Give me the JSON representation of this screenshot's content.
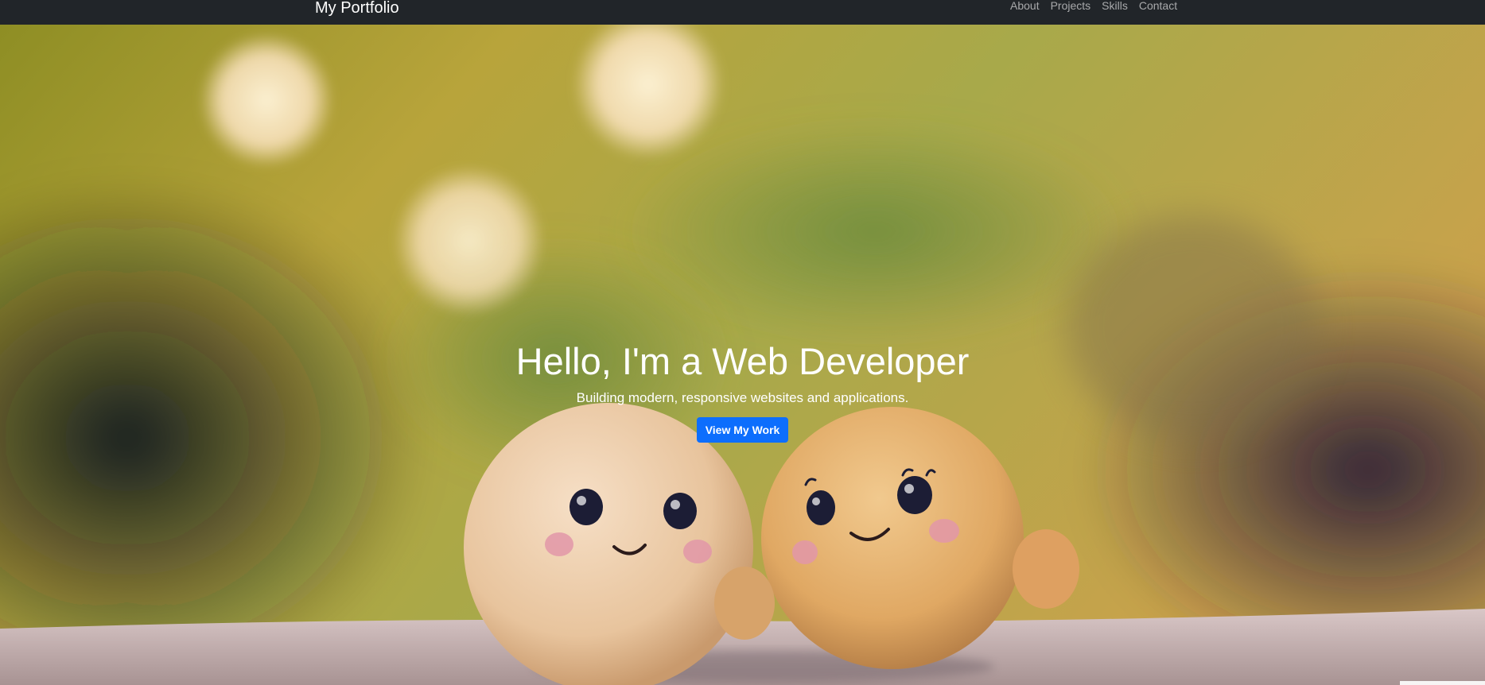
{
  "navbar": {
    "brand": "My Portfolio",
    "links": [
      "About",
      "Projects",
      "Skills",
      "Contact"
    ]
  },
  "hero": {
    "title": "Hello, I'm a Web Developer",
    "subtitle": "Building modern, responsive websites and applications.",
    "cta_label": "View My Work",
    "background_image": "two smiling clay figures on bokeh background"
  },
  "colors": {
    "navbar_bg": "#212529",
    "accent": "#0d6efd",
    "nav_link": "rgba(255,255,255,0.6)",
    "text_light": "#ffffff"
  }
}
